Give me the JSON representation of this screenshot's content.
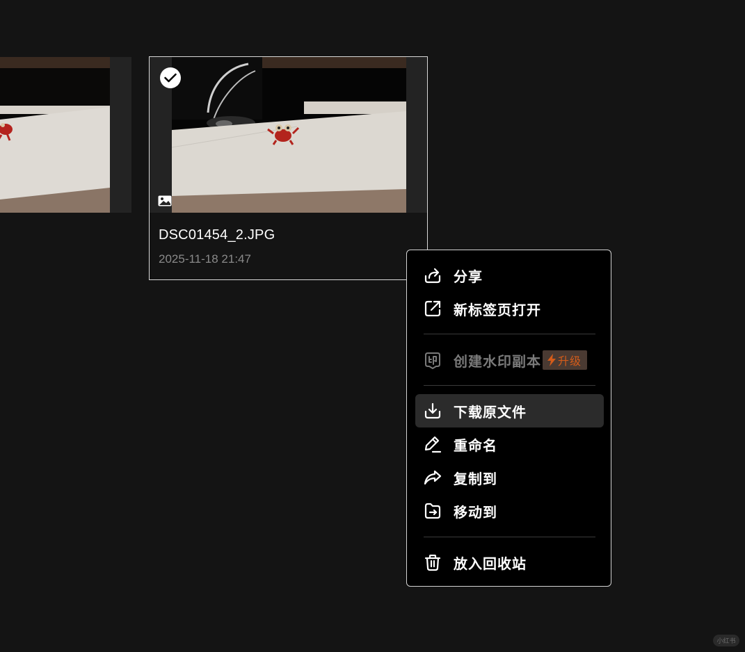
{
  "file": {
    "name": "DSC01454_2.JPG",
    "date": "2025-11-18 21:47"
  },
  "menu": {
    "share": "分享",
    "open_new_tab": "新标签页打开",
    "create_watermark": "创建水印副本",
    "upgrade_badge": "升级",
    "download": "下载原文件",
    "rename": "重命名",
    "copy_to": "复制到",
    "move_to": "移动到",
    "trash": "放入回收站"
  },
  "watermark": "小红书",
  "colors": {
    "background": "#141414",
    "menu_bg": "#000000",
    "hover_bg": "#2b2b2b",
    "badge_text": "#d45c1a",
    "disabled_text": "#7a7a7a"
  }
}
